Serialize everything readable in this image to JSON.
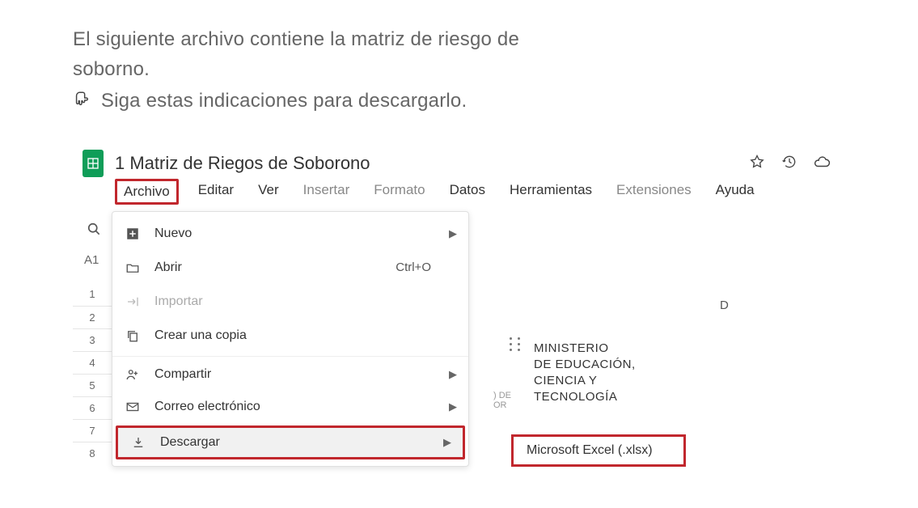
{
  "intro": {
    "line1": "El siguiente archivo contiene la matriz de riesgo de",
    "line2": "soborno.",
    "line3": "Siga estas indicaciones para descargarlo."
  },
  "doc": {
    "title": "1 Matriz de Riegos de Soborono"
  },
  "menu": {
    "archivo": "Archivo",
    "editar": "Editar",
    "ver": "Ver",
    "insertar": "Insertar",
    "formato": "Formato",
    "datos": "Datos",
    "herramientas": "Herramientas",
    "extensiones": "Extensiones",
    "ayuda": "Ayuda"
  },
  "cellref": "A1",
  "rows": {
    "r1": "1",
    "r2": "2",
    "r3": "3",
    "r4": "4",
    "r5": "5",
    "r6": "6",
    "r7": "7",
    "r8": "8"
  },
  "file_menu": {
    "nuevo": "Nuevo",
    "abrir": "Abrir",
    "abrir_short": "Ctrl+O",
    "importar": "Importar",
    "crear_copia": "Crear una copia",
    "compartir": "Compartir",
    "correo": "Correo electrónico",
    "descargar": "Descargar"
  },
  "submenu": {
    "xlsx": "Microsoft Excel (.xlsx)"
  },
  "col": {
    "d": "D"
  },
  "ministerio": {
    "l1": "MINISTERIO",
    "l2": "DE EDUCACIÓN,",
    "l3": "CIENCIA Y",
    "l4": "TECNOLOGÍA"
  },
  "frag": {
    "a": ") DE",
    "b": "OR"
  }
}
